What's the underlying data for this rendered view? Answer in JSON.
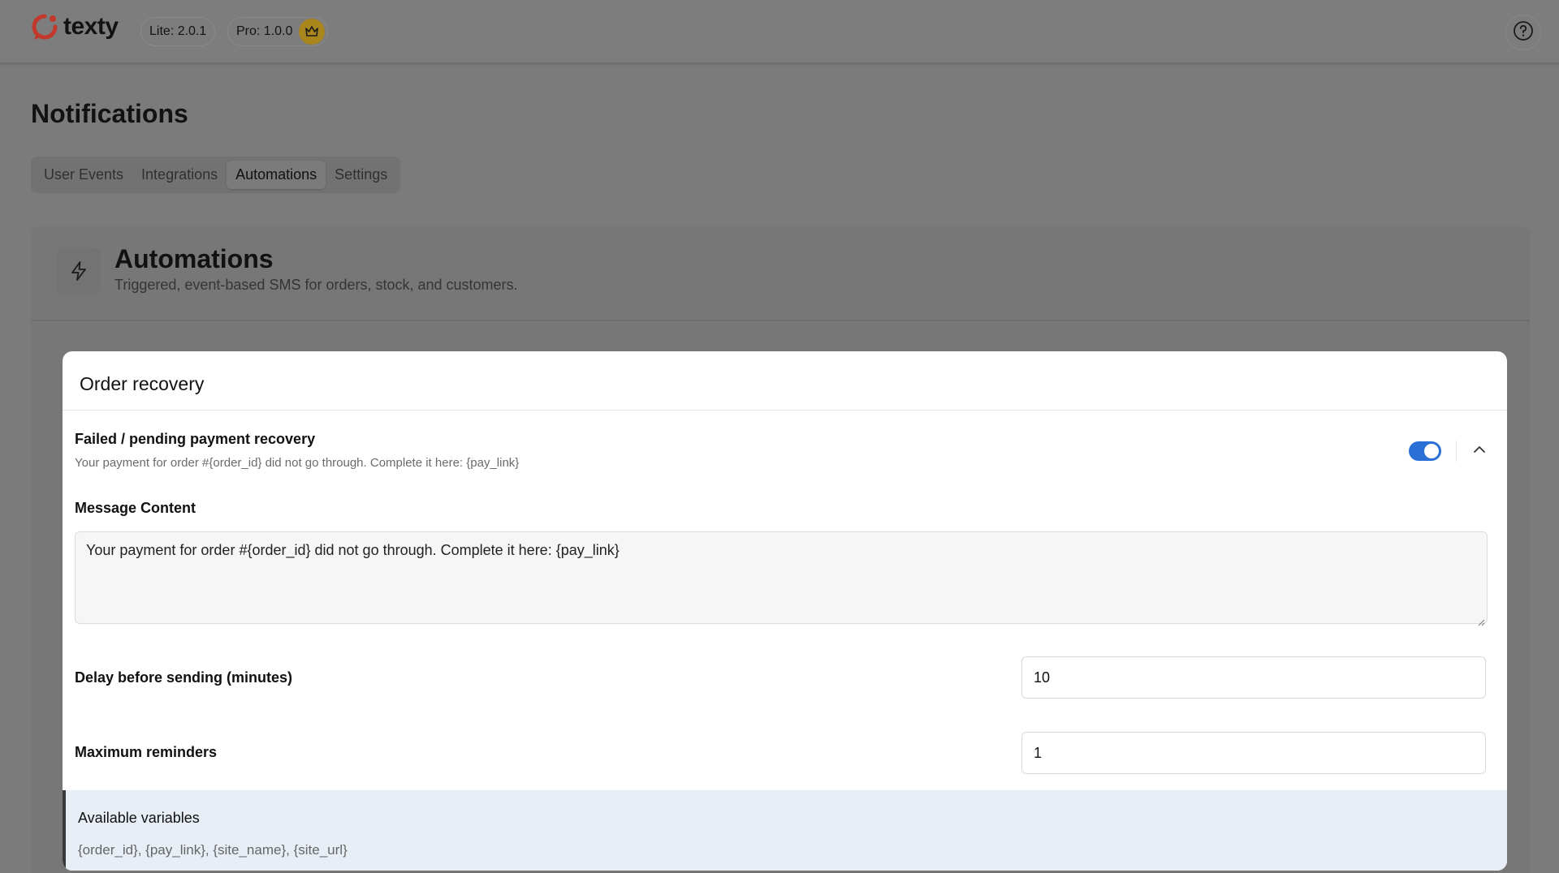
{
  "app": {
    "logo_text": "texty",
    "lite_version": "Lite: 2.0.1",
    "pro_version": "Pro: 1.0.0",
    "crown_icon": "crown-icon",
    "help_icon": "question-circle-icon",
    "brand_color": "#c0392b"
  },
  "page": {
    "title": "Notifications",
    "tabs": [
      {
        "label": "User Events",
        "active": false
      },
      {
        "label": "Integrations",
        "active": false
      },
      {
        "label": "Automations",
        "active": true
      },
      {
        "label": "Settings",
        "active": false
      }
    ]
  },
  "section": {
    "icon": "bolt-icon",
    "title": "Automations",
    "subtitle": "Triggered, event-based SMS for orders, stock, and customers."
  },
  "card": {
    "title": "Order recovery",
    "item": {
      "title": "Failed / pending payment recovery",
      "description": "Your payment for order #{order_id} did not go through. Complete it here: {pay_link}",
      "enabled": true,
      "toggle_color": "#2a6fd6",
      "expand_icon": "chevron-up-icon"
    },
    "message": {
      "label": "Message Content",
      "value": "Your payment for order #{order_id} did not go through. Complete it here: {pay_link}"
    },
    "delay": {
      "label": "Delay before sending (minutes)",
      "value": "10"
    },
    "max_reminders": {
      "label": "Maximum reminders",
      "value": "1"
    },
    "variables": {
      "title": "Available variables",
      "list": "{order_id}, {pay_link}, {site_name}, {site_url}"
    }
  }
}
